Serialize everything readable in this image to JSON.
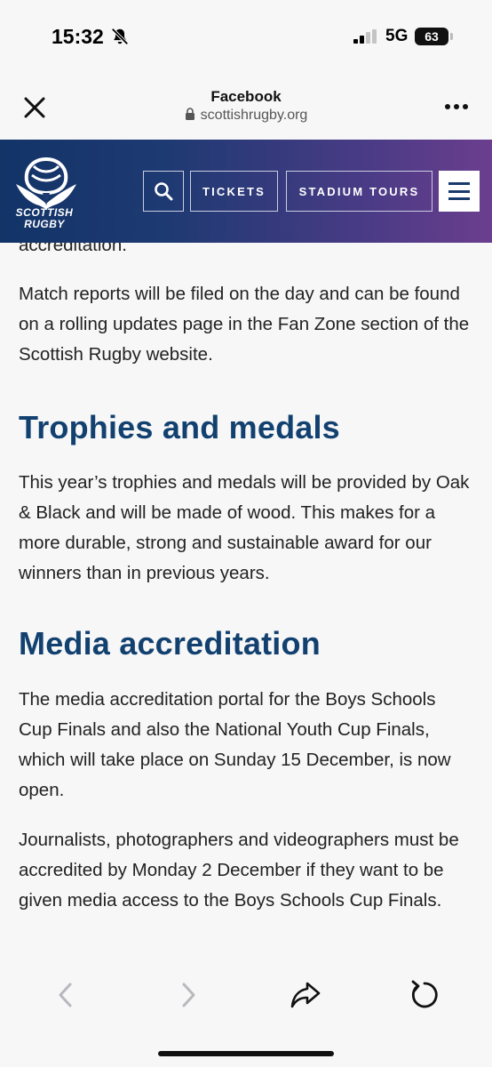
{
  "status_bar": {
    "time": "15:32",
    "network": "5G",
    "battery": "63",
    "icons": [
      "bell-off-icon",
      "signal-icon",
      "battery-icon"
    ]
  },
  "browser": {
    "title": "Facebook",
    "url": "scottishrugby.org",
    "icons": [
      "close-icon",
      "lock-icon",
      "more-icon"
    ]
  },
  "site_header": {
    "logo_line1": "SCOTTISH",
    "logo_line2": "RUGBY",
    "search_icon": "search-icon",
    "tickets_label": "TICKETS",
    "tours_label": "STADIUM TOURS",
    "menu_icon": "hamburger-menu-icon",
    "colors": {
      "gradient_start": "#123467",
      "gradient_end": "#6b3e8e"
    }
  },
  "article": {
    "clipped_line": "accreditation.",
    "para_match_reports": "Match reports will be filed on the day and can be found on a rolling updates page in the Fan Zone section of the Scottish Rugby website.",
    "heading_trophies": "Trophies and medals",
    "para_trophies": "This year’s trophies and medals will be provided by Oak & Black and will be made of wood. This makes for a more durable, strong and sustainable award for our winners than in previous years.",
    "heading_media": "Media accreditation",
    "para_media_portal": "The media accreditation portal for the Boys Schools Cup Finals and also the National Youth Cup Finals, which will take place on Sunday 15 December, is now open.",
    "para_journalists": "Journalists, photographers and videographers must be accredited by Monday 2 December if they want to be given media access to the Boys Schools Cup Finals.",
    "heading_color": "#124170"
  },
  "toolbar": {
    "icons": [
      "back-icon",
      "forward-icon",
      "share-icon",
      "reload-icon"
    ]
  }
}
